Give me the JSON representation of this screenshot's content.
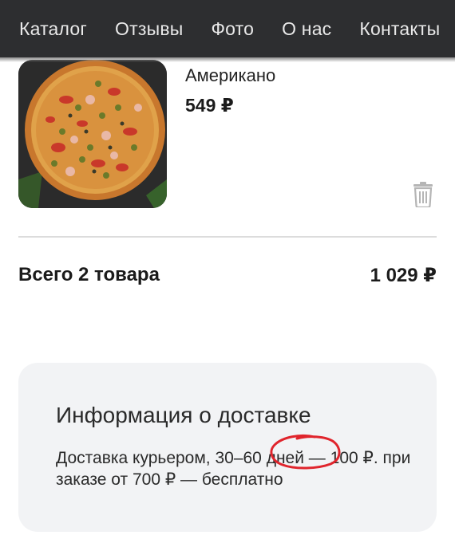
{
  "nav": {
    "items": [
      "Каталог",
      "Отзывы",
      "Фото",
      "О нас",
      "Контакты"
    ]
  },
  "product": {
    "name": "Американо",
    "price": "549 ₽",
    "image": "pizza-photo"
  },
  "icons": {
    "delete": "trash-icon"
  },
  "summary": {
    "label": "Всего 2 товара",
    "total": "1 029 ₽"
  },
  "delivery": {
    "title": "Информация о доставке",
    "text_before": "Доставка курьером, 30–60 ",
    "text_highlight": "дней",
    "text_after": " — 100 ₽. при заказе от 700 ₽ — бесплатно"
  },
  "colors": {
    "nav_bg": "#2d2e30",
    "card_bg": "#f2f3f5",
    "annotation_red": "#e0242c"
  }
}
